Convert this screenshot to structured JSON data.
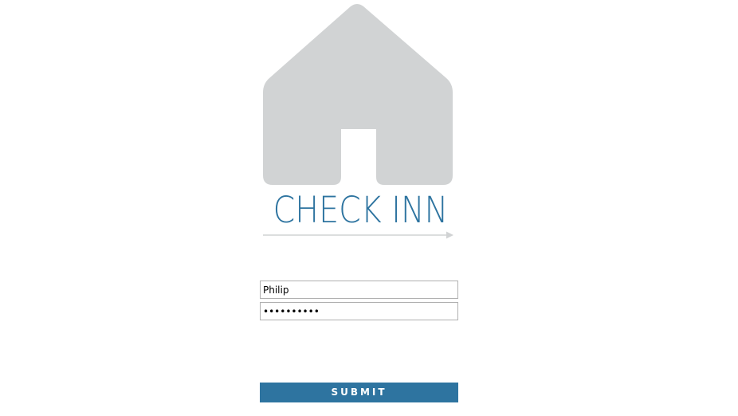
{
  "logo": {
    "brand_text": "CHECK INN",
    "icon": "house-icon",
    "underline_icon": "arrow-right-icon"
  },
  "login": {
    "username_value": "Philip",
    "password_value": "••••••••••",
    "submit_label": "SUBMIT"
  },
  "colors": {
    "accent": "#2e74a0",
    "house": "#d1d3d4",
    "underline": "#d1d3d4",
    "background": "#ffffff"
  }
}
